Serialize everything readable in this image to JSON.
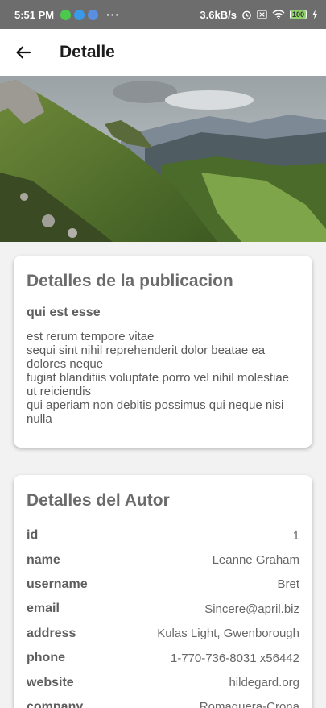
{
  "status": {
    "time": "5:51 PM",
    "speed": "3.6kB/s",
    "battery": "100",
    "app_icons": [
      "chat-app-icon",
      "twitter-icon",
      "whatsapp-icon"
    ],
    "dots": "···"
  },
  "appbar": {
    "back_icon": "arrow-left-icon",
    "title": "Detalle"
  },
  "hero": {
    "alt": "mountain-landscape-image"
  },
  "publication": {
    "heading": "Detalles de la publicacion",
    "title": "qui est esse",
    "body": "est rerum tempore vitae\nsequi sint nihil reprehenderit dolor beatae ea dolores neque\nfugiat blanditiis voluptate porro vel nihil molestiae ut reiciendis\nqui aperiam non debitis possimus qui neque nisi nulla"
  },
  "author": {
    "heading": "Detalles del Autor",
    "rows": [
      {
        "key": "id",
        "value": "1"
      },
      {
        "key": "name",
        "value": "Leanne Graham"
      },
      {
        "key": "username",
        "value": "Bret"
      },
      {
        "key": "email",
        "value": "Sincere@april.biz"
      },
      {
        "key": "address",
        "value": "Kulas Light,  Gwenborough"
      },
      {
        "key": "phone",
        "value": "1-770-736-8031 x56442"
      },
      {
        "key": "website",
        "value": "hildegard.org"
      },
      {
        "key": "company",
        "value": "Romaguera-Crona"
      }
    ]
  },
  "colors": {
    "status_bar": "#6d6d6d",
    "background": "#f2f2f2",
    "card": "#ffffff"
  }
}
